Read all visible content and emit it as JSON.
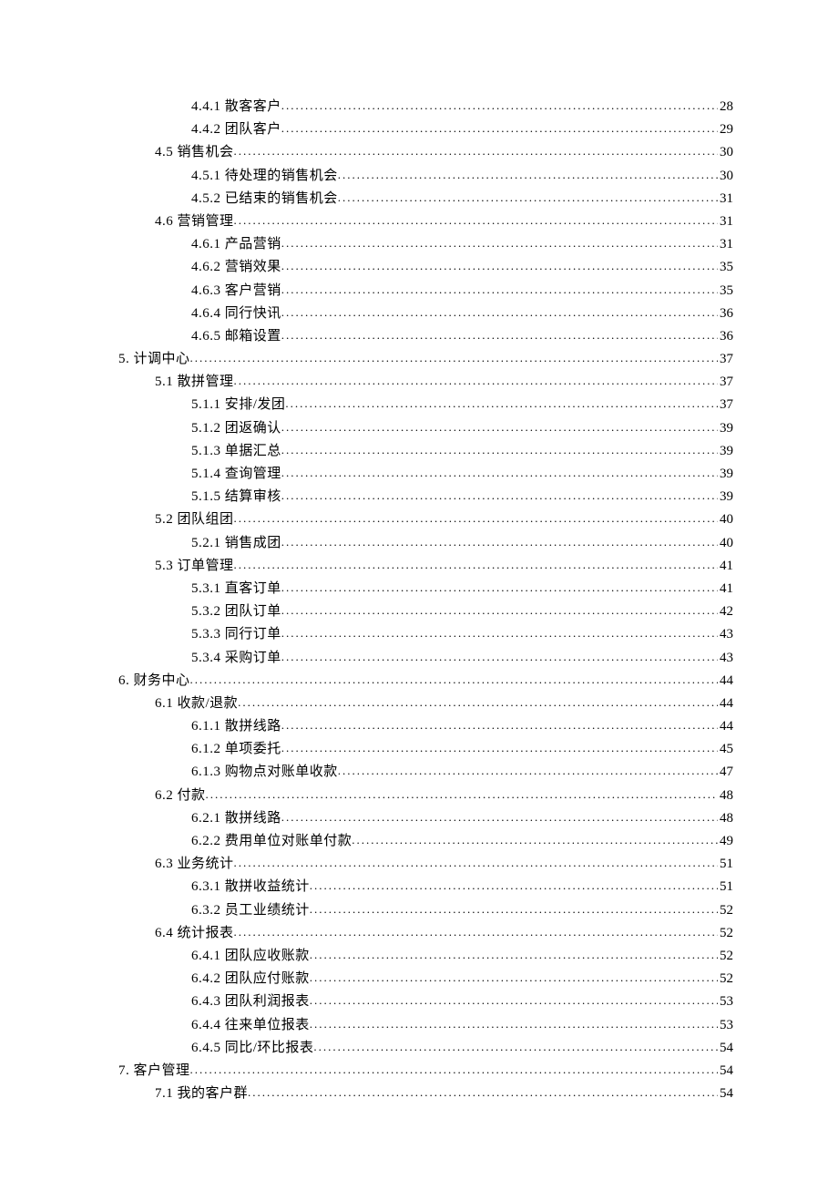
{
  "toc": [
    {
      "level": 2,
      "label": "4.4.1 散客客户",
      "page": "28"
    },
    {
      "level": 2,
      "label": "4.4.2 团队客户",
      "page": "29"
    },
    {
      "level": 1,
      "label": "4.5  销售机会",
      "page": "30"
    },
    {
      "level": 2,
      "label": "4.5.1 待处理的销售机会",
      "page": "30"
    },
    {
      "level": 2,
      "label": "4.5.2 已结束的销售机会",
      "page": "31"
    },
    {
      "level": 1,
      "label": "4.6  营销管理",
      "page": "31"
    },
    {
      "level": 2,
      "label": "4.6.1 产品营销",
      "page": "31"
    },
    {
      "level": 2,
      "label": "4.6.2 营销效果",
      "page": "35"
    },
    {
      "level": 2,
      "label": "4.6.3 客户营销",
      "page": "35"
    },
    {
      "level": 2,
      "label": "4.6.4 同行快讯",
      "page": "36"
    },
    {
      "level": 2,
      "label": "4.6.5 邮箱设置",
      "page": "36"
    },
    {
      "level": 0,
      "label": "5. 计调中心",
      "page": "37"
    },
    {
      "level": 1,
      "label": "5.1  散拼管理",
      "page": "37"
    },
    {
      "level": 2,
      "label": "5.1.1 安排/发团",
      "page": "37"
    },
    {
      "level": 2,
      "label": "5.1.2 团返确认",
      "page": "39"
    },
    {
      "level": 2,
      "label": "5.1.3 单据汇总",
      "page": "39"
    },
    {
      "level": 2,
      "label": "5.1.4 查询管理",
      "page": "39"
    },
    {
      "level": 2,
      "label": "5.1.5 结算审核",
      "page": "39"
    },
    {
      "level": 1,
      "label": "5.2  团队组团",
      "page": "40"
    },
    {
      "level": 2,
      "label": "5.2.1  销售成团",
      "page": "40"
    },
    {
      "level": 1,
      "label": "5.3  订单管理",
      "page": "41"
    },
    {
      "level": 2,
      "label": "5.3.1  直客订单",
      "page": "41"
    },
    {
      "level": 2,
      "label": "5.3.2  团队订单",
      "page": "42"
    },
    {
      "level": 2,
      "label": "5.3.3 同行订单",
      "page": "43"
    },
    {
      "level": 2,
      "label": "5.3.4 采购订单",
      "page": "43"
    },
    {
      "level": 0,
      "label": "6.  财务中心",
      "page": "44"
    },
    {
      "level": 1,
      "label": "6.1 收款/退款",
      "page": "44"
    },
    {
      "level": 2,
      "label": "6.1.1 散拼线路",
      "page": "44"
    },
    {
      "level": 2,
      "label": "6.1.2 单项委托",
      "page": "45"
    },
    {
      "level": 2,
      "label": "6.1.3 购物点对账单收款",
      "page": "47"
    },
    {
      "level": 1,
      "label": "6.2 付款",
      "page": "48"
    },
    {
      "level": 2,
      "label": "6.2.1 散拼线路",
      "page": "48"
    },
    {
      "level": 2,
      "label": "6.2.2 费用单位对账单付款",
      "page": "49"
    },
    {
      "level": 1,
      "label": "6.3 业务统计",
      "page": "51"
    },
    {
      "level": 2,
      "label": "6.3.1 散拼收益统计",
      "page": "51"
    },
    {
      "level": 2,
      "label": "6.3.2 员工业绩统计",
      "page": "52"
    },
    {
      "level": 1,
      "label": "6.4 统计报表",
      "page": "52"
    },
    {
      "level": 2,
      "label": "6.4.1 团队应收账款",
      "page": "52"
    },
    {
      "level": 2,
      "label": "6.4.2 团队应付账款",
      "page": "52"
    },
    {
      "level": 2,
      "label": "6.4.3 团队利润报表",
      "page": "53"
    },
    {
      "level": 2,
      "label": "6.4.4 往来单位报表",
      "page": "53"
    },
    {
      "level": 2,
      "label": "6.4.5 同比/环比报表",
      "page": "54"
    },
    {
      "level": 0,
      "label": "7.  客户管理",
      "page": "54"
    },
    {
      "level": 1,
      "label": "7.1 我的客户群",
      "page": "54"
    }
  ]
}
